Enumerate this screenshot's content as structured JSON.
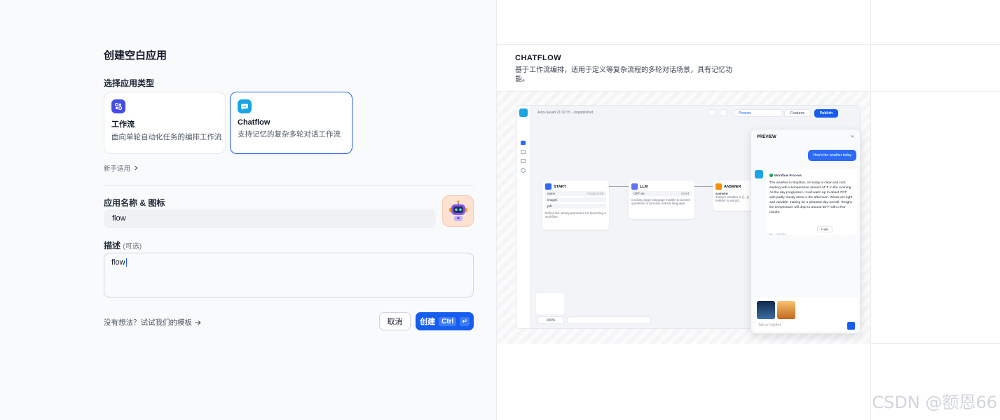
{
  "form": {
    "title": "创建空白应用",
    "type_label": "选择应用类型",
    "types": [
      {
        "name": "工作流",
        "desc": "面向单轮自动化任务的编排工作流",
        "selected": false,
        "icon": "workflow-icon",
        "color": "#444ce7"
      },
      {
        "name": "Chatflow",
        "desc": "支持记忆的复杂多轮对话工作流",
        "selected": true,
        "icon": "chatflow-icon",
        "color": "#1aa4e3"
      }
    ],
    "guide_link": "新手适用",
    "name_label": "应用名称 & 图标",
    "name_value": "flow",
    "avatar_icon": "robot-avatar-icon",
    "desc_label": "描述",
    "desc_optional": "(可选)",
    "desc_value": "flow",
    "template_link": "没有想法？试试我们的模板",
    "cancel_label": "取消",
    "create_label": "创建",
    "create_shortcut": "Ctrl",
    "create_shortcut_key": "↵",
    "accent_color": "#155eef"
  },
  "preview_panel": {
    "title": "CHATFLOW",
    "desc": "基于工作流编排，适用于定义等复杂流程的多轮对话场景，具有记忆功能。",
    "mock": {
      "autosave": "Auto-Saved 21:02:35 · Unpublished",
      "preview_btn": "Preview",
      "features_btn": "Features",
      "publish_btn": "Publish",
      "zoom": "100%",
      "nodes": {
        "start": {
          "title": "START",
          "rows": [
            "name",
            "images",
            "pdf"
          ],
          "row_tag": "REQUIRED",
          "desc": "Define the initial parameters for launching a workflow"
        },
        "llm": {
          "title": "LLM",
          "model": "GPT-4o",
          "mode": "CHAT",
          "desc": "Invoking large language models to answer questions or process natural language"
        },
        "answer": {
          "title": "ANSWER",
          "label": "ANSWER",
          "text": "Today's weather is {{...}} entities to extract."
        }
      },
      "chat": {
        "title": "PREVIEW",
        "user_msg": "How's the weather today",
        "process": "Workflow Process",
        "bot_msg": "The weather in Boydton, VA today is clear and cool, starting with a temperature around 44°F in the morning. As the day progresses, it will warm up to about 73°F with partly cloudy skies in the afternoon. Winds are light and variable, making for a pleasant day overall. Tonight, the temperature will drop to around 50°F with a few clouds.",
        "time": "5/8 · 1:30 PM",
        "logs": "Logs",
        "placeholder": "Talk to DifyBot"
      }
    }
  },
  "watermark": "CSDN @额恩66"
}
